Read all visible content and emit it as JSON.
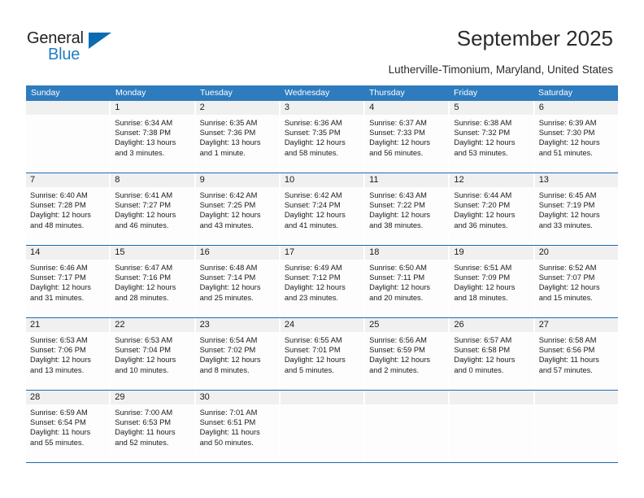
{
  "brand": {
    "name_part1": "General",
    "name_part2": "Blue",
    "triangle_color": "#0d6cb0",
    "blue_color": "#1f7dc4"
  },
  "header": {
    "title": "September 2025",
    "subtitle": "Lutherville-Timonium, Maryland, United States"
  },
  "theme": {
    "header_blue": "#2e7cbe",
    "row_rule_blue": "#1f6cb0",
    "day_band_gray": "#f0f0f0"
  },
  "weekdays": [
    "Sunday",
    "Monday",
    "Tuesday",
    "Wednesday",
    "Thursday",
    "Friday",
    "Saturday"
  ],
  "weeks": [
    [
      {
        "day": "",
        "lines": []
      },
      {
        "day": "1",
        "lines": [
          "Sunrise: 6:34 AM",
          "Sunset: 7:38 PM",
          "Daylight: 13 hours",
          "and 3 minutes."
        ]
      },
      {
        "day": "2",
        "lines": [
          "Sunrise: 6:35 AM",
          "Sunset: 7:36 PM",
          "Daylight: 13 hours",
          "and 1 minute."
        ]
      },
      {
        "day": "3",
        "lines": [
          "Sunrise: 6:36 AM",
          "Sunset: 7:35 PM",
          "Daylight: 12 hours",
          "and 58 minutes."
        ]
      },
      {
        "day": "4",
        "lines": [
          "Sunrise: 6:37 AM",
          "Sunset: 7:33 PM",
          "Daylight: 12 hours",
          "and 56 minutes."
        ]
      },
      {
        "day": "5",
        "lines": [
          "Sunrise: 6:38 AM",
          "Sunset: 7:32 PM",
          "Daylight: 12 hours",
          "and 53 minutes."
        ]
      },
      {
        "day": "6",
        "lines": [
          "Sunrise: 6:39 AM",
          "Sunset: 7:30 PM",
          "Daylight: 12 hours",
          "and 51 minutes."
        ]
      }
    ],
    [
      {
        "day": "7",
        "lines": [
          "Sunrise: 6:40 AM",
          "Sunset: 7:28 PM",
          "Daylight: 12 hours",
          "and 48 minutes."
        ]
      },
      {
        "day": "8",
        "lines": [
          "Sunrise: 6:41 AM",
          "Sunset: 7:27 PM",
          "Daylight: 12 hours",
          "and 46 minutes."
        ]
      },
      {
        "day": "9",
        "lines": [
          "Sunrise: 6:42 AM",
          "Sunset: 7:25 PM",
          "Daylight: 12 hours",
          "and 43 minutes."
        ]
      },
      {
        "day": "10",
        "lines": [
          "Sunrise: 6:42 AM",
          "Sunset: 7:24 PM",
          "Daylight: 12 hours",
          "and 41 minutes."
        ]
      },
      {
        "day": "11",
        "lines": [
          "Sunrise: 6:43 AM",
          "Sunset: 7:22 PM",
          "Daylight: 12 hours",
          "and 38 minutes."
        ]
      },
      {
        "day": "12",
        "lines": [
          "Sunrise: 6:44 AM",
          "Sunset: 7:20 PM",
          "Daylight: 12 hours",
          "and 36 minutes."
        ]
      },
      {
        "day": "13",
        "lines": [
          "Sunrise: 6:45 AM",
          "Sunset: 7:19 PM",
          "Daylight: 12 hours",
          "and 33 minutes."
        ]
      }
    ],
    [
      {
        "day": "14",
        "lines": [
          "Sunrise: 6:46 AM",
          "Sunset: 7:17 PM",
          "Daylight: 12 hours",
          "and 31 minutes."
        ]
      },
      {
        "day": "15",
        "lines": [
          "Sunrise: 6:47 AM",
          "Sunset: 7:16 PM",
          "Daylight: 12 hours",
          "and 28 minutes."
        ]
      },
      {
        "day": "16",
        "lines": [
          "Sunrise: 6:48 AM",
          "Sunset: 7:14 PM",
          "Daylight: 12 hours",
          "and 25 minutes."
        ]
      },
      {
        "day": "17",
        "lines": [
          "Sunrise: 6:49 AM",
          "Sunset: 7:12 PM",
          "Daylight: 12 hours",
          "and 23 minutes."
        ]
      },
      {
        "day": "18",
        "lines": [
          "Sunrise: 6:50 AM",
          "Sunset: 7:11 PM",
          "Daylight: 12 hours",
          "and 20 minutes."
        ]
      },
      {
        "day": "19",
        "lines": [
          "Sunrise: 6:51 AM",
          "Sunset: 7:09 PM",
          "Daylight: 12 hours",
          "and 18 minutes."
        ]
      },
      {
        "day": "20",
        "lines": [
          "Sunrise: 6:52 AM",
          "Sunset: 7:07 PM",
          "Daylight: 12 hours",
          "and 15 minutes."
        ]
      }
    ],
    [
      {
        "day": "21",
        "lines": [
          "Sunrise: 6:53 AM",
          "Sunset: 7:06 PM",
          "Daylight: 12 hours",
          "and 13 minutes."
        ]
      },
      {
        "day": "22",
        "lines": [
          "Sunrise: 6:53 AM",
          "Sunset: 7:04 PM",
          "Daylight: 12 hours",
          "and 10 minutes."
        ]
      },
      {
        "day": "23",
        "lines": [
          "Sunrise: 6:54 AM",
          "Sunset: 7:02 PM",
          "Daylight: 12 hours",
          "and 8 minutes."
        ]
      },
      {
        "day": "24",
        "lines": [
          "Sunrise: 6:55 AM",
          "Sunset: 7:01 PM",
          "Daylight: 12 hours",
          "and 5 minutes."
        ]
      },
      {
        "day": "25",
        "lines": [
          "Sunrise: 6:56 AM",
          "Sunset: 6:59 PM",
          "Daylight: 12 hours",
          "and 2 minutes."
        ]
      },
      {
        "day": "26",
        "lines": [
          "Sunrise: 6:57 AM",
          "Sunset: 6:58 PM",
          "Daylight: 12 hours",
          "and 0 minutes."
        ]
      },
      {
        "day": "27",
        "lines": [
          "Sunrise: 6:58 AM",
          "Sunset: 6:56 PM",
          "Daylight: 11 hours",
          "and 57 minutes."
        ]
      }
    ],
    [
      {
        "day": "28",
        "lines": [
          "Sunrise: 6:59 AM",
          "Sunset: 6:54 PM",
          "Daylight: 11 hours",
          "and 55 minutes."
        ]
      },
      {
        "day": "29",
        "lines": [
          "Sunrise: 7:00 AM",
          "Sunset: 6:53 PM",
          "Daylight: 11 hours",
          "and 52 minutes."
        ]
      },
      {
        "day": "30",
        "lines": [
          "Sunrise: 7:01 AM",
          "Sunset: 6:51 PM",
          "Daylight: 11 hours",
          "and 50 minutes."
        ]
      },
      {
        "day": "",
        "lines": []
      },
      {
        "day": "",
        "lines": []
      },
      {
        "day": "",
        "lines": []
      },
      {
        "day": "",
        "lines": []
      }
    ]
  ]
}
